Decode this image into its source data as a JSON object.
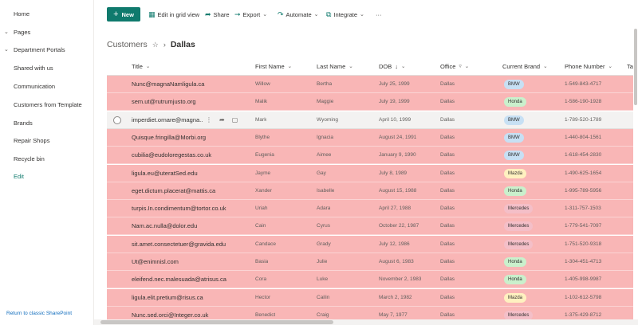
{
  "nav": {
    "items": [
      {
        "label": "Home",
        "chevron": false
      },
      {
        "label": "Pages",
        "chevron": true
      },
      {
        "label": "Department Portals",
        "chevron": true
      },
      {
        "label": "Shared with us",
        "chevron": false
      },
      {
        "label": "Communication",
        "chevron": false
      },
      {
        "label": "Customers from Template",
        "chevron": false
      },
      {
        "label": "Brands",
        "chevron": false
      },
      {
        "label": "Repair Shops",
        "chevron": false
      },
      {
        "label": "Recycle bin",
        "chevron": false
      },
      {
        "label": "Edit",
        "chevron": false
      }
    ],
    "return_link": "Return to classic SharePoint"
  },
  "commandbar": {
    "new_label": "New",
    "grid_view_label": "Edit in grid view",
    "share_label": "Share",
    "export_label": "Export",
    "automate_label": "Automate",
    "integrate_label": "Integrate",
    "more_label": "···"
  },
  "breadcrumb": {
    "root": "Customers",
    "current": "Dallas"
  },
  "columns": {
    "title": "Title",
    "first_name": "First Name",
    "last_name": "Last Name",
    "dob": "DOB",
    "dob_sort": "↓",
    "office": "Office",
    "brand": "Current Brand",
    "phone": "Phone Number",
    "truncated": "Ta"
  },
  "brand_colors": {
    "BMW": "#c7e0f4",
    "Honda": "#caf0cc",
    "Mazda": "#fff1c0",
    "Mercedes": "#f4bfc8"
  },
  "highlight_color": "#f9b6b6",
  "rows": [
    {
      "title": "Nunc@magnaNamligula.ca",
      "first": "Willow",
      "last": "Bertha",
      "dob": "July 25, 1999",
      "office": "Dallas",
      "brand": "BMW",
      "phone": "1-549-843-4717",
      "highlighted": true
    },
    {
      "title": "sem.ut@rutrumjusto.org",
      "first": "Malik",
      "last": "Maggie",
      "dob": "July 19, 1999",
      "office": "Dallas",
      "brand": "Honda",
      "phone": "1-586-190-1928",
      "highlighted": true
    },
    {
      "title": "imperdiet.ornare@magna...",
      "first": "Mark",
      "last": "Wyoming",
      "dob": "April 10, 1999",
      "office": "Dallas",
      "brand": "BMW",
      "phone": "1-789-520-1789",
      "highlighted": false
    },
    {
      "title": "Quisque.fringilla@Morbi.org",
      "first": "Blythe",
      "last": "Ignacia",
      "dob": "August 24, 1991",
      "office": "Dallas",
      "brand": "BMW",
      "phone": "1-440-804-1561",
      "highlighted": true
    },
    {
      "title": "cubilia@eudoloregestas.co.uk",
      "first": "Eugenia",
      "last": "Aimee",
      "dob": "January 9, 1990",
      "office": "Dallas",
      "brand": "BMW",
      "phone": "1-618-454-2830",
      "highlighted": true
    },
    {
      "title": "ligula.eu@uteratSed.edu",
      "first": "Jayme",
      "last": "Gay",
      "dob": "July 8, 1989",
      "office": "Dallas",
      "brand": "Mazda",
      "phone": "1-490-625-1654",
      "highlighted": true
    },
    {
      "title": "eget.dictum.placerat@mattis.ca",
      "first": "Xander",
      "last": "Isabelle",
      "dob": "August 15, 1988",
      "office": "Dallas",
      "brand": "Honda",
      "phone": "1-995-789-5956",
      "highlighted": true
    },
    {
      "title": "turpis.In.condimentum@tortor.co.uk",
      "first": "Uriah",
      "last": "Adara",
      "dob": "April 27, 1988",
      "office": "Dallas",
      "brand": "Mercedes",
      "phone": "1-311-757-1503",
      "highlighted": true
    },
    {
      "title": "Nam.ac.nulla@dolor.edu",
      "first": "Cain",
      "last": "Cyrus",
      "dob": "October 22, 1987",
      "office": "Dallas",
      "brand": "Mercedes",
      "phone": "1-779-541-7097",
      "highlighted": true
    },
    {
      "title": "sit.amet.consectetuer@gravida.edu",
      "first": "Candace",
      "last": "Grady",
      "dob": "July 12, 1986",
      "office": "Dallas",
      "brand": "Mercedes",
      "phone": "1-751-520-9318",
      "highlighted": true
    },
    {
      "title": "Ut@enimnisl.com",
      "first": "Basia",
      "last": "Julie",
      "dob": "August 6, 1983",
      "office": "Dallas",
      "brand": "Honda",
      "phone": "1-304-451-4713",
      "highlighted": true
    },
    {
      "title": "eleifend.nec.malesuada@atrisus.ca",
      "first": "Cora",
      "last": "Luke",
      "dob": "November 2, 1983",
      "office": "Dallas",
      "brand": "Honda",
      "phone": "1-405-998-9987",
      "highlighted": true
    },
    {
      "title": "ligula.elit.pretium@risus.ca",
      "first": "Hector",
      "last": "Cailin",
      "dob": "March 2, 1982",
      "office": "Dallas",
      "brand": "Mazda",
      "phone": "1-102-612-5798",
      "highlighted": true
    },
    {
      "title": "Nunc.sed.orci@Integer.co.uk",
      "first": "Benedict",
      "last": "Craig",
      "dob": "May 7, 1977",
      "office": "Dallas",
      "brand": "Mercedes",
      "phone": "1-375-429-8712",
      "highlighted": true
    }
  ]
}
